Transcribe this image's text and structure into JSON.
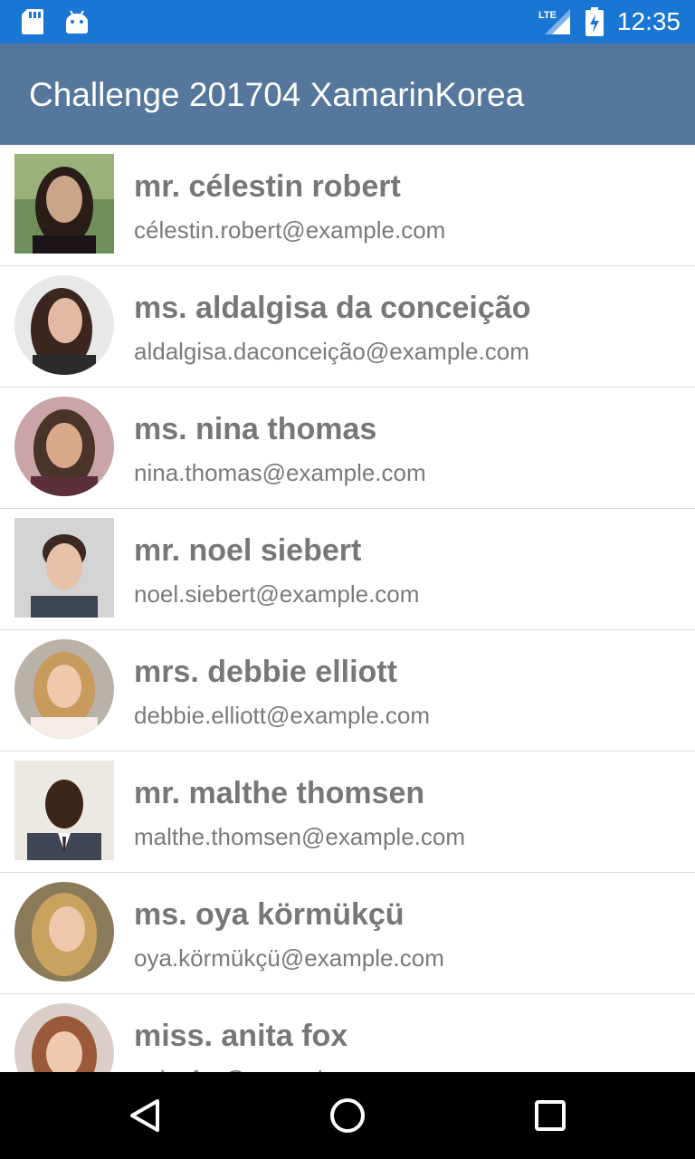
{
  "status_bar": {
    "time": "12:35",
    "network_label": "LTE",
    "icons": [
      "sd-card-icon",
      "android-icon",
      "lte-signal-icon",
      "battery-icon"
    ]
  },
  "app_bar": {
    "title": "Challenge 201704 XamarinKorea"
  },
  "contacts": [
    {
      "name": "mr. célestin robert",
      "email": "célestin.robert@example.com",
      "avatar": "photo-square"
    },
    {
      "name": "ms. aldalgisa da conceição",
      "email": "aldalgisa.daconceição@example.com",
      "avatar": "photo-round"
    },
    {
      "name": "ms. nina thomas",
      "email": "nina.thomas@example.com",
      "avatar": "photo-round"
    },
    {
      "name": "mr. noel siebert",
      "email": "noel.siebert@example.com",
      "avatar": "photo-square"
    },
    {
      "name": "mrs. debbie elliott",
      "email": "debbie.elliott@example.com",
      "avatar": "photo-round"
    },
    {
      "name": "mr. malthe thomsen",
      "email": "malthe.thomsen@example.com",
      "avatar": "photo-square"
    },
    {
      "name": "ms. oya körmükçü",
      "email": "oya.körmükçü@example.com",
      "avatar": "photo-round"
    },
    {
      "name": "miss. anita fox",
      "email": "anita.fox@example.com",
      "avatar": "photo-round"
    }
  ],
  "nav_bar": {
    "icons": [
      "back-icon",
      "home-icon",
      "recents-icon"
    ]
  },
  "colors": {
    "status_bar": "#1976d2",
    "app_bar": "#54779b",
    "name_text": "#777777",
    "email_text": "#7a7a7a",
    "divider": "#dcdcdc",
    "nav_bar": "#000000"
  }
}
